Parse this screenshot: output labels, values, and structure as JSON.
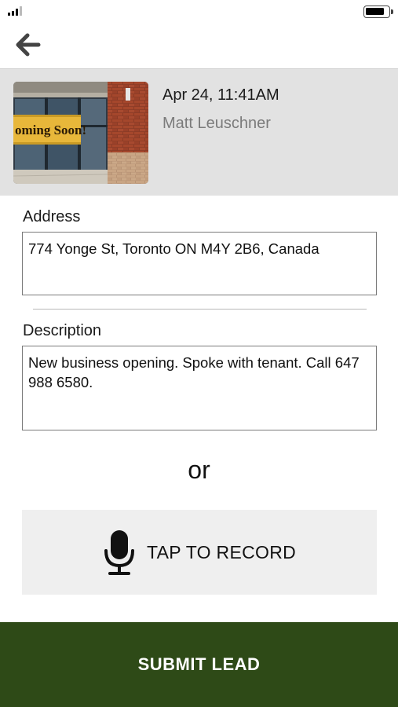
{
  "lead": {
    "datetime": "Apr 24, 11:41AM",
    "author": "Matt Leuschner",
    "photo_sign_text": "oming Soon!"
  },
  "address": {
    "label": "Address",
    "value": "774 Yonge St, Toronto ON M4Y 2B6, Canada"
  },
  "description": {
    "label": "Description",
    "value": "New business opening. Spoke with tenant. Call 647 988 6580."
  },
  "or_text": "or",
  "record": {
    "label": "TAP TO RECORD"
  },
  "submit": {
    "label": "SUBMIT LEAD"
  }
}
